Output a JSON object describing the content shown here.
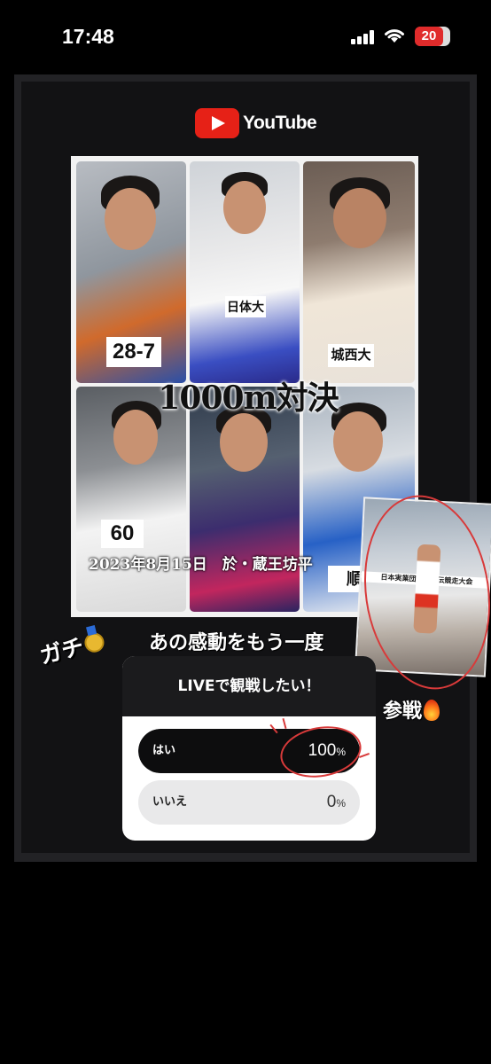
{
  "status_bar": {
    "time": "17:48",
    "battery": "20",
    "icons": [
      "signal-icon",
      "wifi-icon",
      "battery-icon"
    ]
  },
  "story": {
    "logo_text": "YouTube",
    "poster": {
      "title": "1000m対決",
      "date_line": "2023年8月15日　於・蔵王坊平",
      "bibs": [
        "28-7",
        "日体大",
        "城西大",
        "60",
        "",
        "順"
      ]
    },
    "stickers": {
      "gachi": "ガチ",
      "headline": "あの感動をもう一度",
      "sansen": "参戦"
    },
    "inset_banner": "日本実業団対抗駅伝競走大会",
    "poll": {
      "question": "LIVEで観戦したい！",
      "options": [
        {
          "label": "はい",
          "percent": "100",
          "unit": "%",
          "fill": 1.0
        },
        {
          "label": "いいえ",
          "percent": "0",
          "unit": "%",
          "fill": 0.0
        }
      ]
    }
  },
  "colors": {
    "accent_red": "#d83a3a",
    "youtube_red": "#e62117",
    "panel_bg": "#222225"
  }
}
